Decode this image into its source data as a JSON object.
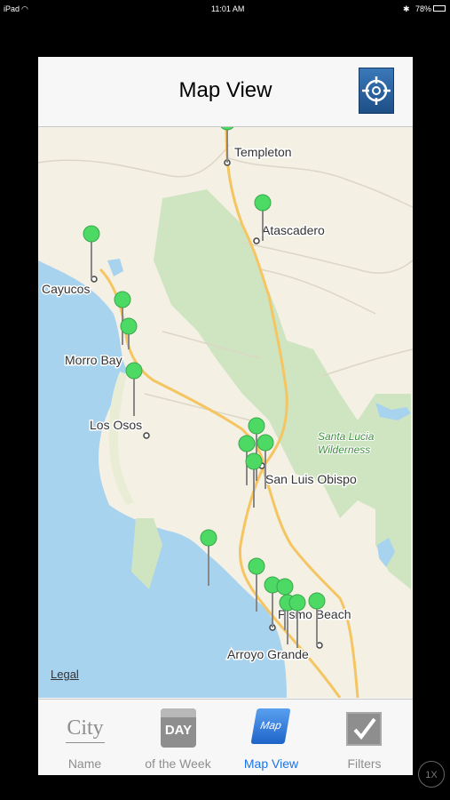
{
  "status": {
    "device": "iPad",
    "time": "11:01 AM",
    "battery": "78%"
  },
  "nav": {
    "title": "Map View",
    "locate_icon": "crosshair-target-icon"
  },
  "map": {
    "places": [
      "Templeton",
      "Atascadero",
      "Cayucos",
      "Morro Bay",
      "Los Osos",
      "San Luis Obispo",
      "Pismo Beach",
      "Arroyo Grande"
    ],
    "wilderness": [
      "Santa Lucia",
      "Wilderness"
    ],
    "legal": "Legal",
    "pin_color": "#4cd964"
  },
  "tabs": [
    {
      "label": "Name",
      "icon_text": "City",
      "icon": "city-icon"
    },
    {
      "label": "of the Week",
      "icon_text": "DAY",
      "icon": "calendar-day-icon"
    },
    {
      "label": "Map View",
      "icon_text": "Map",
      "icon": "map-icon"
    },
    {
      "label": "Filters",
      "icon": "checkbox-filter-icon"
    }
  ],
  "active_tab": "Map View",
  "zoom_badge": "1X"
}
